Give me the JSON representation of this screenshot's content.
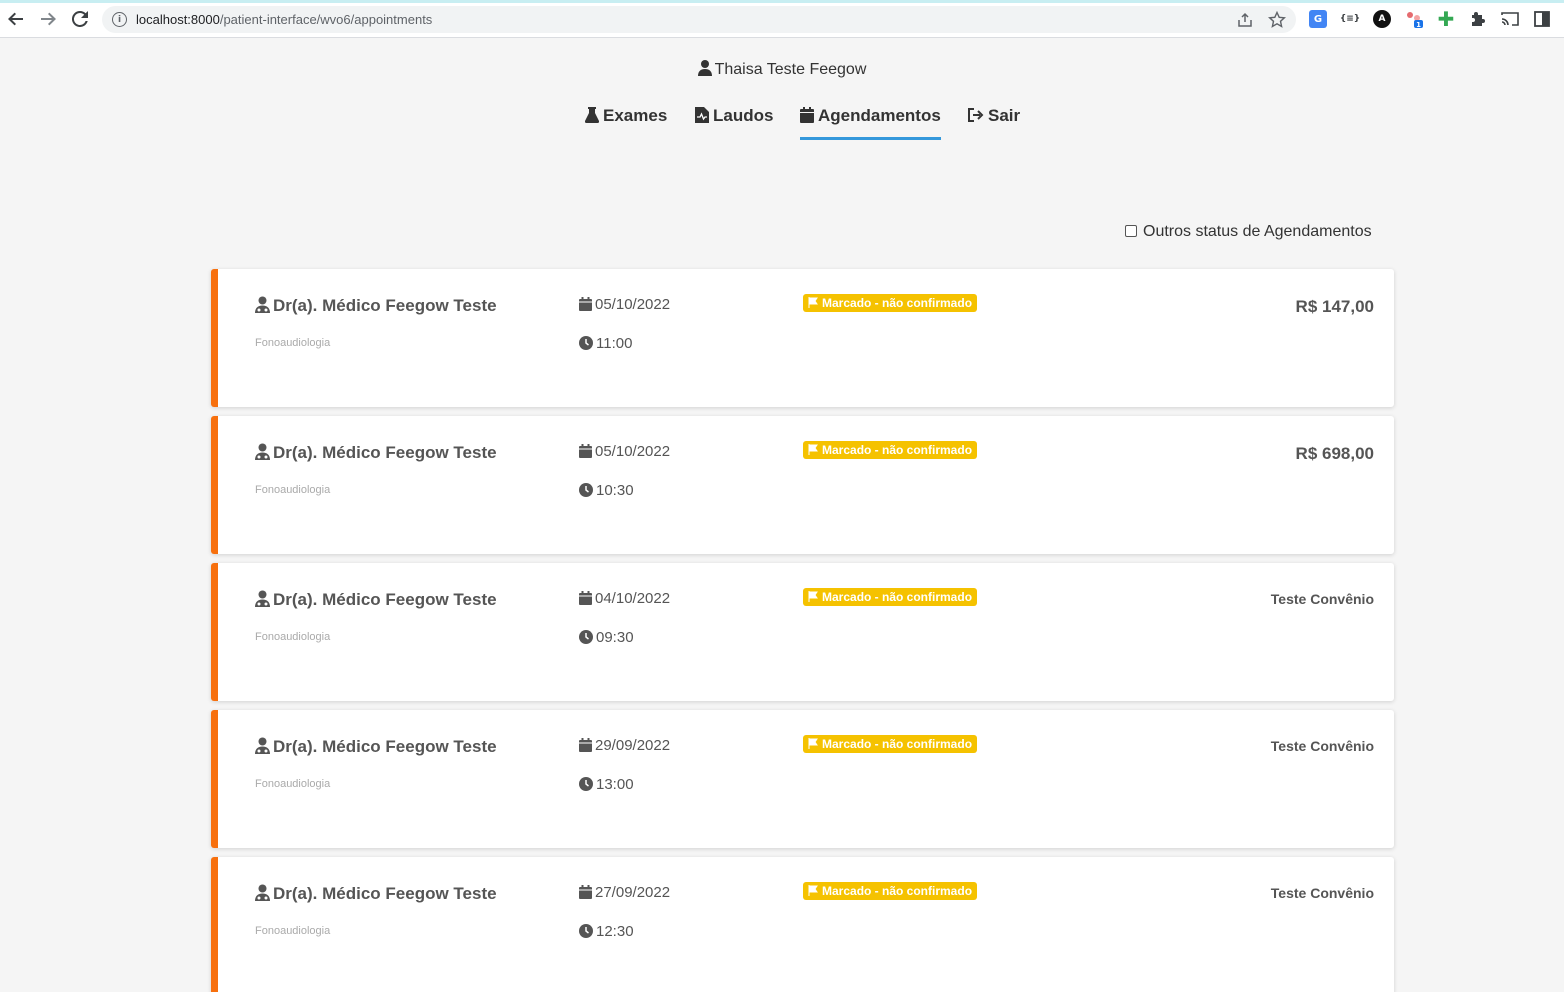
{
  "browser": {
    "url_host": "localhost:8000",
    "url_path": "/patient-interface/wvo6/appointments"
  },
  "user": {
    "name": "Thaisa Teste Feegow"
  },
  "menu": {
    "items": [
      {
        "label": "Exames",
        "icon": "flask-icon"
      },
      {
        "label": "Laudos",
        "icon": "file-medical-icon"
      },
      {
        "label": "Agendamentos",
        "icon": "calendar-icon",
        "active": true
      },
      {
        "label": "Sair",
        "icon": "sign-out-icon"
      }
    ]
  },
  "filter": {
    "label": "Outros status de Agendamentos",
    "checked": false
  },
  "appointments": [
    {
      "doctor": "Dr(a). Médico Feegow Teste",
      "specialty": "Fonoaudiologia",
      "date": "05/10/2022",
      "time": "11:00",
      "status": "Marcado - não confirmado",
      "amount": "R$ 147,00"
    },
    {
      "doctor": "Dr(a). Médico Feegow Teste",
      "specialty": "Fonoaudiologia",
      "date": "05/10/2022",
      "time": "10:30",
      "status": "Marcado - não confirmado",
      "amount": "R$ 698,00"
    },
    {
      "doctor": "Dr(a). Médico Feegow Teste",
      "specialty": "Fonoaudiologia",
      "date": "04/10/2022",
      "time": "09:30",
      "status": "Marcado - não confirmado",
      "amount": "Teste Convênio"
    },
    {
      "doctor": "Dr(a). Médico Feegow Teste",
      "specialty": "Fonoaudiologia",
      "date": "29/09/2022",
      "time": "13:00",
      "status": "Marcado - não confirmado",
      "amount": "Teste Convênio"
    },
    {
      "doctor": "Dr(a). Médico Feegow Teste",
      "specialty": "Fonoaudiologia",
      "date": "27/09/2022",
      "time": "12:30",
      "status": "Marcado - não confirmado",
      "amount": "Teste Convênio"
    }
  ],
  "colors": {
    "accent_border": "#f7700e",
    "badge": "#f5c200",
    "active_tab": "#3498db"
  }
}
